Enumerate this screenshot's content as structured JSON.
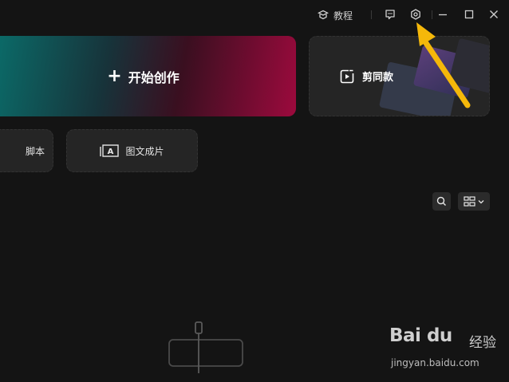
{
  "topbar": {
    "tutorial_label": "教程",
    "icons": [
      "tutorial-icon",
      "feedback-icon",
      "settings-icon",
      "minimize-icon",
      "maximize-icon",
      "close-icon"
    ]
  },
  "cards": {
    "start_create": {
      "label": "开始创作",
      "icon": "plus-icon"
    },
    "same_style": {
      "label": "剪同款",
      "icon": "same-style-icon"
    },
    "script": {
      "label": "脚本"
    },
    "image_text": {
      "label": "图文成片",
      "icon": "image-text-icon"
    }
  },
  "toolbar": {
    "icons": [
      "search-icon",
      "view-toggle-icon",
      "chevron-down-icon"
    ]
  },
  "empty_state": {
    "icon": "empty-draft-icon"
  },
  "annotation": {
    "icon": "arrow-icon",
    "color": "#f5b80a"
  },
  "watermark": {
    "brand": "Bai du",
    "suffix": "经验",
    "url": "jingyan.baidu.com"
  },
  "colors": {
    "background": "#141414",
    "card": "#252525",
    "gradient_start": "#0a6e6b",
    "gradient_end": "#9c0a3d"
  }
}
